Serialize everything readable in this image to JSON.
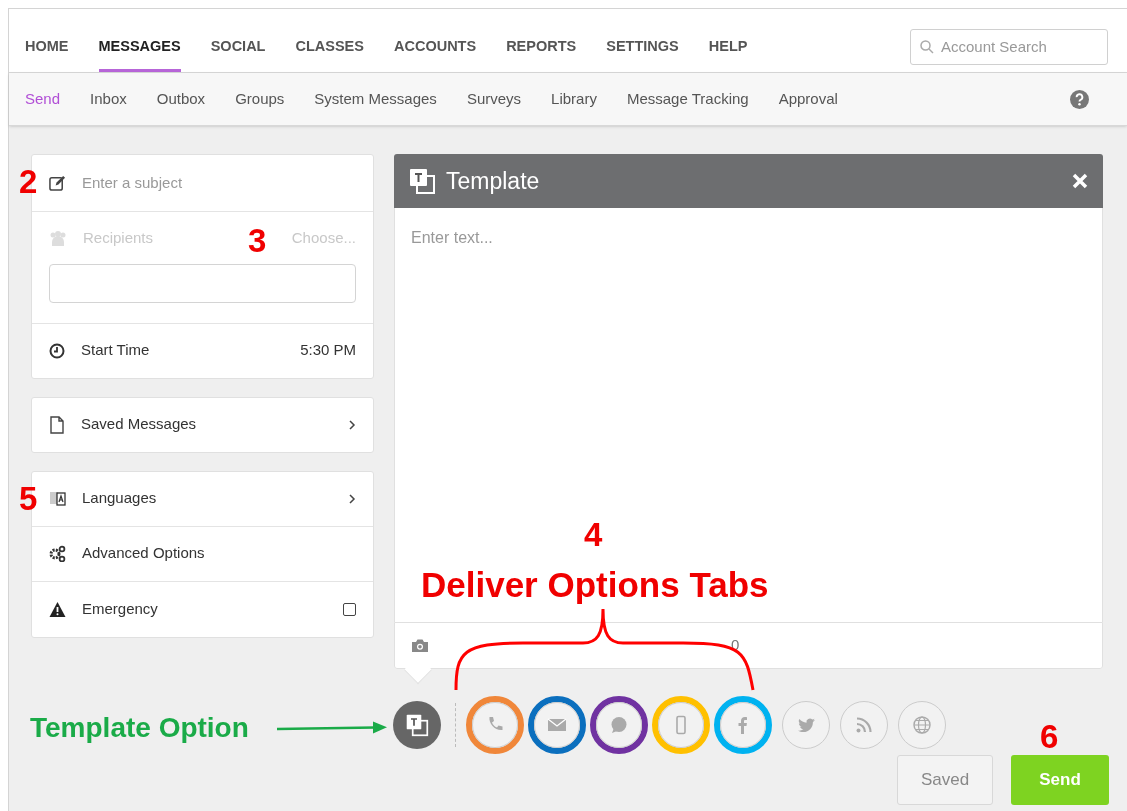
{
  "nav": {
    "items": [
      {
        "label": "HOME",
        "selected": false
      },
      {
        "label": "MESSAGES",
        "selected": true
      },
      {
        "label": "SOCIAL",
        "selected": false
      },
      {
        "label": "CLASSES",
        "selected": false
      },
      {
        "label": "ACCOUNTS",
        "selected": false
      },
      {
        "label": "REPORTS",
        "selected": false
      },
      {
        "label": "SETTINGS",
        "selected": false
      },
      {
        "label": "HELP",
        "selected": false
      }
    ],
    "search": {
      "placeholder": "Account Search"
    }
  },
  "subnav": {
    "items": [
      {
        "label": "Send",
        "selected": true
      },
      {
        "label": "Inbox",
        "selected": false
      },
      {
        "label": "Outbox",
        "selected": false
      },
      {
        "label": "Groups",
        "selected": false
      },
      {
        "label": "System Messages",
        "selected": false
      },
      {
        "label": "Surveys",
        "selected": false
      },
      {
        "label": "Library",
        "selected": false
      },
      {
        "label": "Message Tracking",
        "selected": false
      },
      {
        "label": "Approval",
        "selected": false
      }
    ]
  },
  "compose": {
    "subject": {
      "placeholder": "Enter a subject"
    },
    "recipients": {
      "label": "Recipients",
      "action": "Choose...",
      "disabled": true
    },
    "start_time": {
      "label": "Start Time",
      "value": "5:30 PM"
    },
    "saved_messages": {
      "label": "Saved Messages"
    },
    "options": [
      {
        "kind": "link",
        "label": "Languages"
      },
      {
        "kind": "plain",
        "label": "Advanced Options"
      },
      {
        "kind": "checkbox",
        "label": "Emergency",
        "checked": false
      }
    ]
  },
  "template": {
    "title": "Template",
    "placeholder": "Enter text...",
    "char_count": "0"
  },
  "template_option": {
    "selected": true
  },
  "channels": [
    {
      "kind": "phone",
      "color": "#f0873a"
    },
    {
      "kind": "email",
      "color": "#0b6fbe"
    },
    {
      "kind": "chat",
      "color": "#7032a1"
    },
    {
      "kind": "mobile",
      "color": "#ffc000"
    },
    {
      "kind": "facebook",
      "color": "#00b2f0"
    },
    {
      "kind": "twitter"
    },
    {
      "kind": "rss"
    },
    {
      "kind": "web"
    }
  ],
  "buttons": {
    "saved": "Saved",
    "send": "Send"
  },
  "annotations": {
    "subject": "2",
    "recipients": "3",
    "languages": "5",
    "channels": "4",
    "send": "6",
    "channels_label": "Deliver Options Tabs",
    "template_label": "Template Option"
  }
}
